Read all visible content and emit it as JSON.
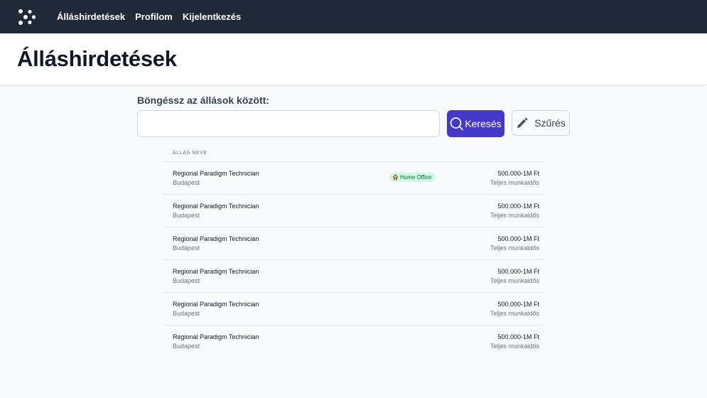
{
  "nav": {
    "links": [
      "Álláshirdetések",
      "Profilom",
      "Kijelentkezés"
    ]
  },
  "header": {
    "title": "Álláshirdetések"
  },
  "search": {
    "label": "Böngéssz az állások között:",
    "value": "",
    "search_button": "Keresés",
    "filter_button": "Szűrés"
  },
  "list": {
    "column_header": "ÁLLÁS NEVE",
    "rows": [
      {
        "title": "Regional Paradigm Technician",
        "city": "Budapest",
        "salary": "500.000-1M Ft",
        "worktype": "Teljes munkaidős",
        "badge": "Home Office"
      },
      {
        "title": "Regional Paradigm Technician",
        "city": "Budapest",
        "salary": "500.000-1M Ft",
        "worktype": "Teljes munkaidős"
      },
      {
        "title": "Regional Paradigm Technician",
        "city": "Budapest",
        "salary": "500.000-1M Ft",
        "worktype": "Teljes munkaidős"
      },
      {
        "title": "Regional Paradigm Technician",
        "city": "Budapest",
        "salary": "500.000-1M Ft",
        "worktype": "Teljes munkaidős"
      },
      {
        "title": "Regional Paradigm Technician",
        "city": "Budapest",
        "salary": "500.000-1M Ft",
        "worktype": "Teljes munkaidős"
      },
      {
        "title": "Regional Paradigm Technician",
        "city": "Budapest",
        "salary": "500.000-1M Ft",
        "worktype": "Teljes munkaidős"
      }
    ]
  },
  "icons": {
    "logo": "logo-icon",
    "search": "search-icon",
    "filter": "pencil-icon",
    "badge": "house-icon"
  },
  "colors": {
    "nav_bg": "#1f2937",
    "primary": "#4338ca",
    "badge_bg": "#d1fae5",
    "badge_text": "#065f46"
  }
}
